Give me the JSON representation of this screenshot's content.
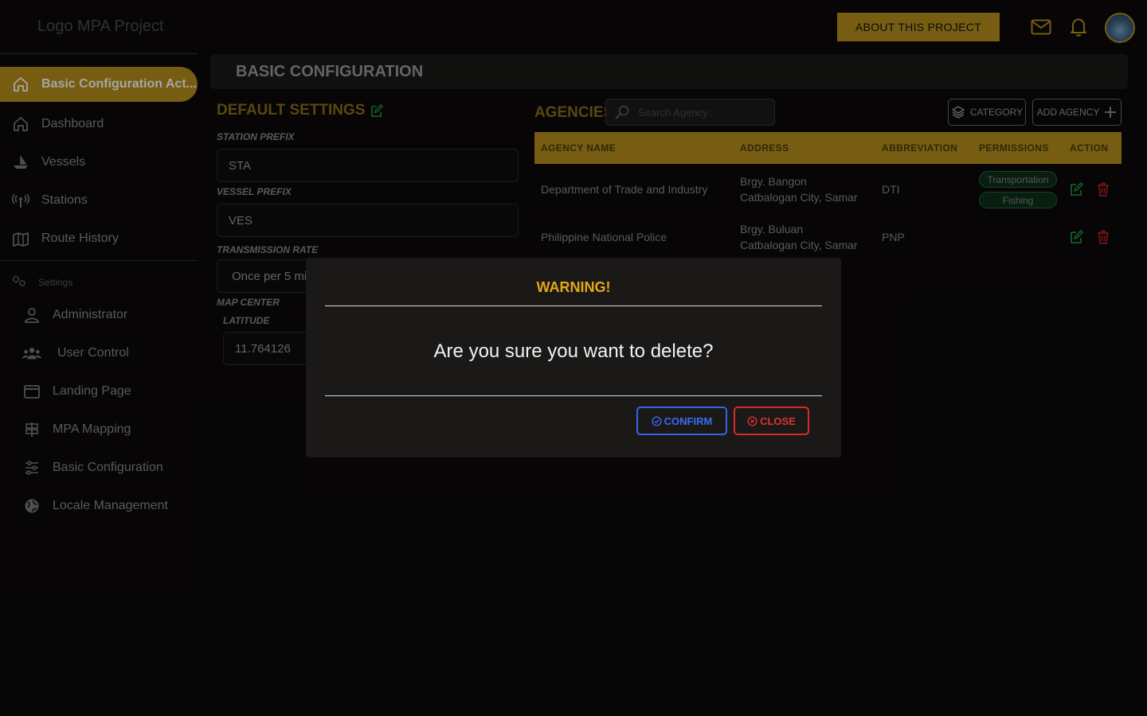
{
  "header": {
    "logo": "Logo MPA Project",
    "about_label": "ABOUT THIS PROJECT",
    "icons": [
      "mail-icon",
      "bell-icon"
    ]
  },
  "sidebar": {
    "active_label": "Basic Configuration Act...",
    "items": [
      {
        "label": "Dashboard",
        "icon": "home-icon"
      },
      {
        "label": "Vessels",
        "icon": "ship-icon"
      },
      {
        "label": "Stations",
        "icon": "antenna-icon"
      },
      {
        "label": "Route History",
        "icon": "map-icon"
      }
    ],
    "section_label": "Settings",
    "settings_items": [
      {
        "label": "Administrator",
        "icon": "user-icon"
      },
      {
        "label": "User Control",
        "icon": "users-icon"
      },
      {
        "label": "Landing Page",
        "icon": "window-icon"
      },
      {
        "label": "MPA Mapping",
        "icon": "signpost-icon"
      },
      {
        "label": "Basic Configuration",
        "icon": "sliders-icon"
      },
      {
        "label": "Locale Management",
        "icon": "globe-icon"
      }
    ]
  },
  "main": {
    "title": "BASIC CONFIGURATION",
    "default_settings": {
      "heading": "DEFAULT SETTINGS",
      "station_prefix_label": "STATION PREFIX",
      "station_prefix_value": "STA",
      "vessel_prefix_label": "VESSEL PREFIX",
      "vessel_prefix_value": "VES",
      "transmission_rate_label": "TRANSMISSION RATE",
      "transmission_rate_value": "Once per 5 mi",
      "map_center_label": "MAP CENTER",
      "latitude_label": "LATITUDE",
      "latitude_value": "11.764126"
    },
    "agencies": {
      "heading": "AGENCIES",
      "search_placeholder": "Search Agency...",
      "category_label": "CATEGORY",
      "add_agency_label": "ADD AGENCY",
      "columns": [
        "AGENCY NAME",
        "ADDRESS",
        "ABBREVIATION",
        "PERMISSIONS",
        "ACTION"
      ],
      "rows": [
        {
          "name": "Department of Trade and Industry",
          "address_line1": "Brgy. Bangon",
          "address_line2": "Catbalogan City, Samar",
          "abbreviation": "DTI",
          "permissions": [
            "Transportation",
            "Fishing"
          ]
        },
        {
          "name": "Philippine National Police",
          "address_line1": "Brgy. Buluan",
          "address_line2": "Catbalogan City, Samar",
          "abbreviation": "PNP",
          "permissions": []
        }
      ]
    }
  },
  "modal": {
    "title": "WARNING!",
    "message": "Are you sure you want to delete?",
    "confirm_label": "CONFIRM",
    "close_label": "CLOSE"
  },
  "colors": {
    "accent": "#b58f1c",
    "warning": "#e3a81a",
    "confirm": "#3563e9",
    "danger": "#d42a2a",
    "edit": "#27a745"
  }
}
